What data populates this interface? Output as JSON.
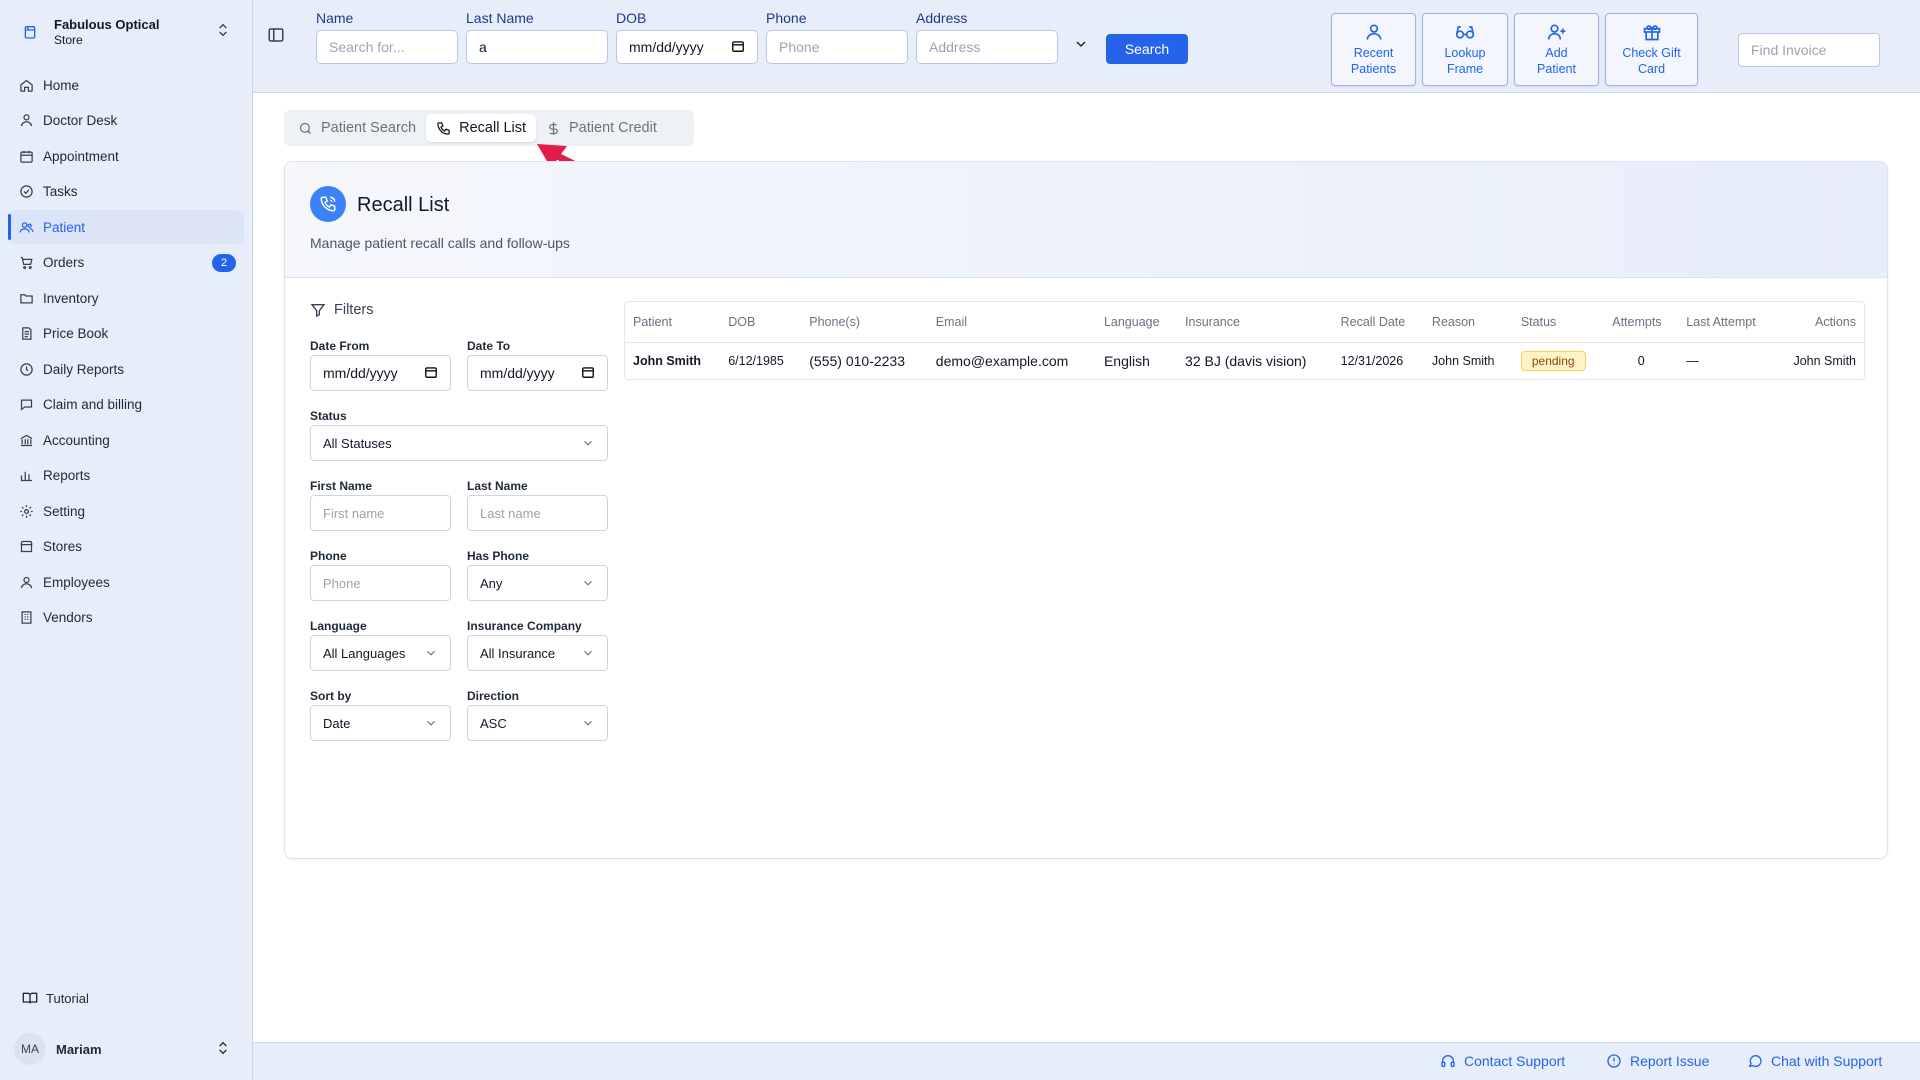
{
  "store": {
    "name": "Fabulous Optical",
    "sub": "Store"
  },
  "nav": [
    {
      "label": "Home",
      "icon": "home-icon"
    },
    {
      "label": "Doctor Desk",
      "icon": "doctor-icon"
    },
    {
      "label": "Appointment",
      "icon": "calendar-icon"
    },
    {
      "label": "Tasks",
      "icon": "check-circle-icon"
    },
    {
      "label": "Patient",
      "icon": "users-icon",
      "active": true
    },
    {
      "label": "Orders",
      "icon": "cart-icon",
      "badge": "2"
    },
    {
      "label": "Inventory",
      "icon": "folder-icon"
    },
    {
      "label": "Price Book",
      "icon": "book-icon"
    },
    {
      "label": "Daily Reports",
      "icon": "clock-icon"
    },
    {
      "label": "Claim and billing",
      "icon": "chat-icon"
    },
    {
      "label": "Accounting",
      "icon": "bank-icon"
    },
    {
      "label": "Reports",
      "icon": "bar-chart-icon"
    },
    {
      "label": "Setting",
      "icon": "gear-icon"
    },
    {
      "label": "Stores",
      "icon": "store-icon"
    },
    {
      "label": "Employees",
      "icon": "user-icon"
    },
    {
      "label": "Vendors",
      "icon": "building-icon"
    }
  ],
  "tutorial": "Tutorial",
  "user": {
    "initials": "MA",
    "name": "Mariam"
  },
  "search": {
    "name_label": "Name",
    "name_placeholder": "Search for...",
    "last_label": "Last Name",
    "last_value": "a",
    "dob_label": "DOB",
    "dob_value": "mm/dd/yyyy",
    "phone_label": "Phone",
    "phone_placeholder": "Phone",
    "address_label": "Address",
    "address_placeholder": "Address",
    "button": "Search"
  },
  "quick": [
    {
      "line1": "Recent",
      "line2": "Patients",
      "icon": "person-icon"
    },
    {
      "line1": "Lookup",
      "line2": "Frame",
      "icon": "glasses-icon"
    },
    {
      "line1": "Add",
      "line2": "Patient",
      "icon": "user-plus-icon"
    },
    {
      "line1": "Check Gift",
      "line2": "Card",
      "icon": "gift-icon"
    }
  ],
  "find_invoice_placeholder": "Find Invoice",
  "tabs": [
    {
      "label": "Patient Search",
      "icon": "search-icon"
    },
    {
      "label": "Recall List",
      "icon": "phone-icon",
      "active": true
    },
    {
      "label": "Patient Credit",
      "icon": "dollar-icon"
    }
  ],
  "card": {
    "title": "Recall List",
    "subtitle": "Manage patient recall calls and follow-ups"
  },
  "filters": {
    "title": "Filters",
    "date_from_label": "Date From",
    "date_from_value": "mm/dd/yyyy",
    "date_to_label": "Date To",
    "date_to_value": "mm/dd/yyyy",
    "status_label": "Status",
    "status_value": "All Statuses",
    "first_label": "First Name",
    "first_placeholder": "First name",
    "last_label": "Last Name",
    "last_placeholder": "Last name",
    "phone_label": "Phone",
    "phone_placeholder": "Phone",
    "has_phone_label": "Has Phone",
    "has_phone_value": "Any",
    "language_label": "Language",
    "language_value": "All Languages",
    "insurance_label": "Insurance Company",
    "insurance_value": "All Insurance",
    "sort_label": "Sort by",
    "sort_value": "Date",
    "direction_label": "Direction",
    "direction_value": "ASC"
  },
  "table": {
    "headers": [
      "Patient",
      "DOB",
      "Phone(s)",
      "Email",
      "Language",
      "Insurance",
      "Recall Date",
      "Reason",
      "Status",
      "Attempts",
      "Last Attempt",
      "Actions"
    ],
    "rows": [
      {
        "patient": "John Smith",
        "dob": "6/12/1985",
        "phone": "(555) 010-2233",
        "email": "demo@example.com",
        "language": "English",
        "insurance": "32 BJ (davis vision)",
        "recall_date": "12/31/2026",
        "reason": "John Smith",
        "status": "pending",
        "attempts": "0",
        "last_attempt": "—",
        "actions": "John Smith"
      }
    ]
  },
  "footer": {
    "contact": "Contact Support",
    "report": "Report Issue",
    "chat": "Chat with Support"
  },
  "colors": {
    "accent": "#2563eb",
    "sidebar_bg": "#e8eef9",
    "arrow": "#e11d48",
    "pending_bg": "#fef3c7"
  }
}
